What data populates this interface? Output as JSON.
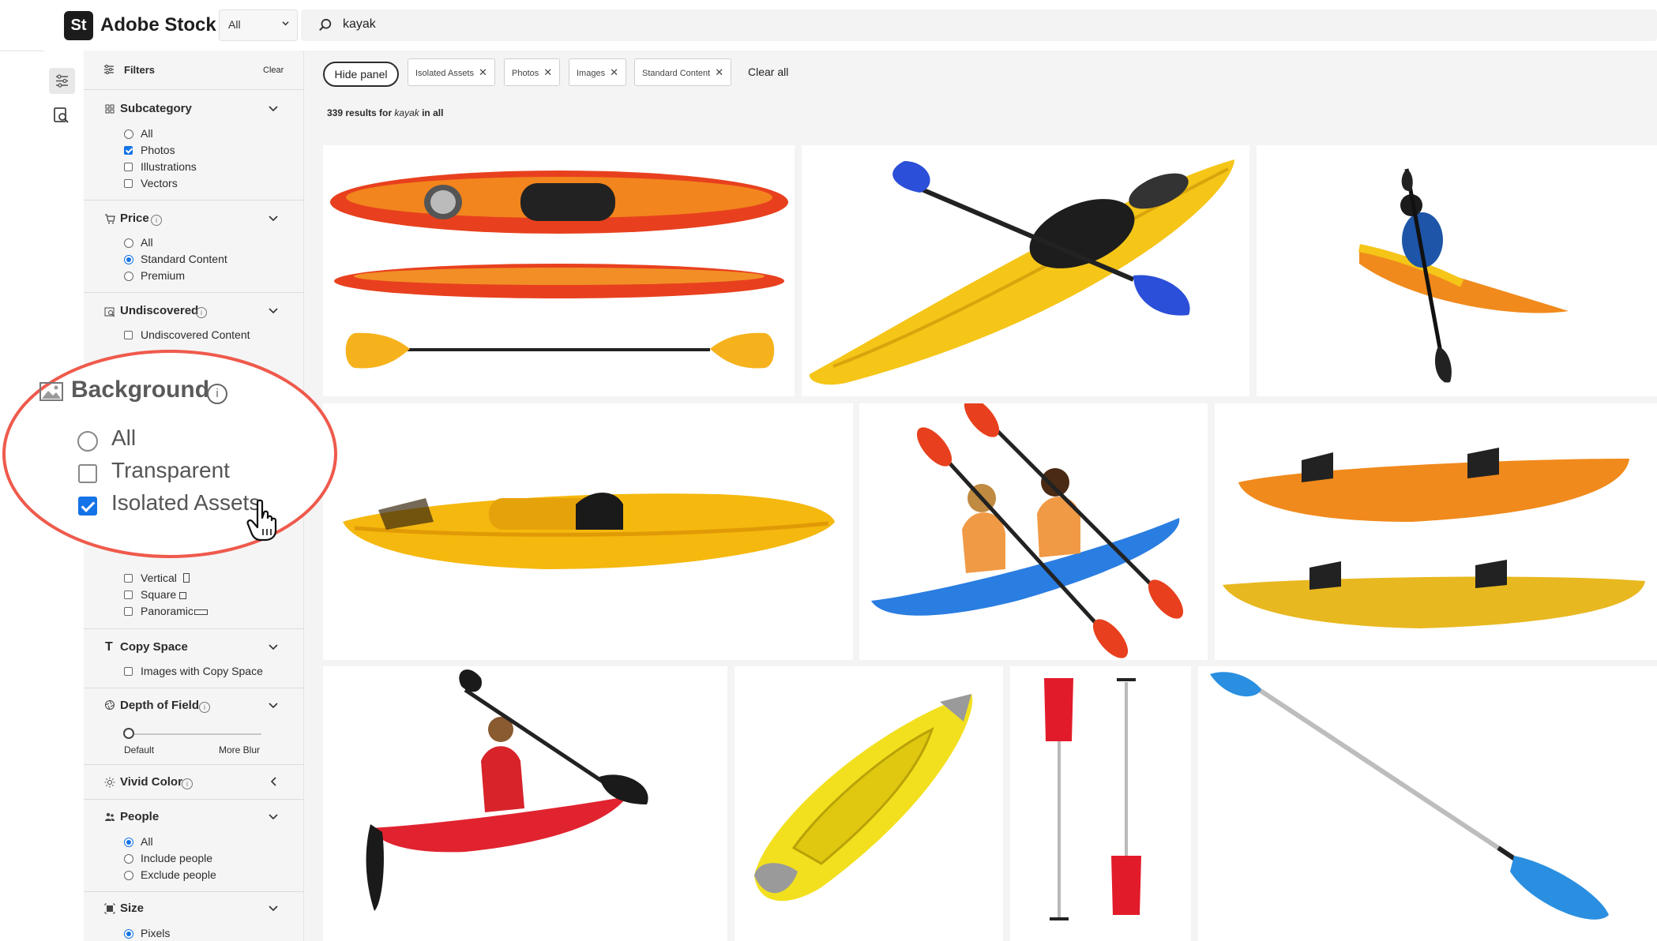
{
  "header": {
    "logo_text": "St",
    "brand": "Adobe Stock",
    "scope_value": "All",
    "search_value": "kayak"
  },
  "filters": {
    "title": "Filters",
    "clear_label": "Clear",
    "subcategory": {
      "title": "Subcategory",
      "options": [
        "All",
        "Photos",
        "Illustrations",
        "Vectors"
      ],
      "selected": [
        "Photos"
      ]
    },
    "price": {
      "title": "Price",
      "options": [
        "All",
        "Standard Content",
        "Premium"
      ],
      "selected": "Standard Content"
    },
    "undiscovered": {
      "title": "Undiscovered",
      "options": [
        "Undiscovered Content"
      ]
    },
    "orientation": {
      "options": [
        "Vertical",
        "Square",
        "Panoramic"
      ]
    },
    "copy_space": {
      "title": "Copy Space",
      "options": [
        "Images with Copy Space"
      ]
    },
    "depth_of_field": {
      "title": "Depth of Field",
      "min_label": "Default",
      "max_label": "More Blur",
      "value": 0
    },
    "vivid_color": {
      "title": "Vivid Color"
    },
    "people": {
      "title": "People",
      "options": [
        "All",
        "Include people",
        "Exclude people"
      ],
      "selected": "All"
    },
    "size": {
      "title": "Size",
      "options": [
        "Pixels"
      ],
      "selected": "Pixels"
    }
  },
  "callout": {
    "title": "Background",
    "options": [
      "All",
      "Transparent",
      "Isolated Assets"
    ],
    "selected": "Isolated Assets"
  },
  "toolbar": {
    "hide_panel": "Hide panel",
    "chips": [
      "Isolated Assets",
      "Photos",
      "Images",
      "Standard Content"
    ],
    "clear_all": "Clear all"
  },
  "results": {
    "count": "339 results for",
    "query": "kayak",
    "scope": "in all"
  },
  "colors": {
    "accent": "#1473e6",
    "callout": "#ef5a4c",
    "kayak_yellow": "#f5c518",
    "kayak_red": "#e63b2e",
    "kayak_orange": "#f08a1c",
    "kayak_blue": "#2a7de1"
  },
  "tiles": [
    {
      "name": "orange-kayak-with-paddle"
    },
    {
      "name": "yellow-kayak-blue-paddle"
    },
    {
      "name": "kayaker-orange-kayak"
    },
    {
      "name": "yellow-kayak-side"
    },
    {
      "name": "couple-in-blue-kayak"
    },
    {
      "name": "two-orange-yellow-kayaks"
    },
    {
      "name": "woman-red-kayak"
    },
    {
      "name": "inflatable-yellow-kayak"
    },
    {
      "name": "two-red-paddles"
    },
    {
      "name": "blue-paddle"
    }
  ]
}
